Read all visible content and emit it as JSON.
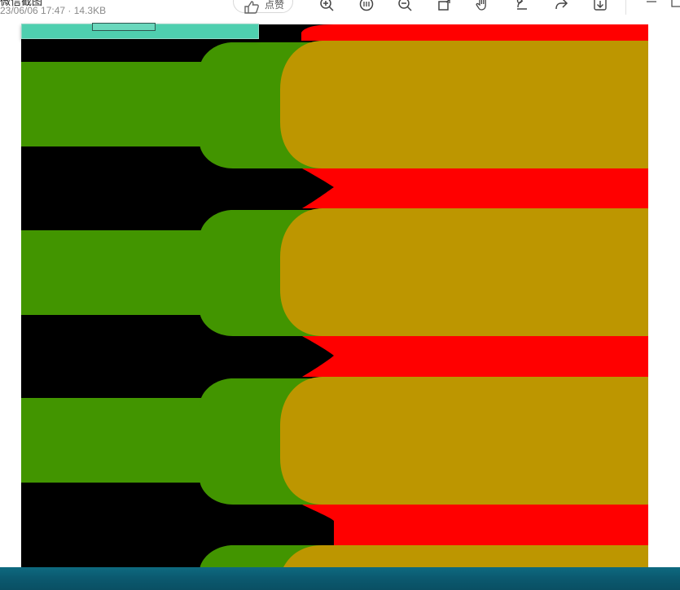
{
  "file": {
    "name": "微信截图",
    "meta": "23/06/06 17:47 · 14.3KB"
  },
  "toolbar": {
    "like_label": "点赞",
    "tools": [
      "zoom-in-icon",
      "fit-icon",
      "zoom-out-icon",
      "rotate-icon",
      "hand-icon",
      "edit-image-icon",
      "share-icon",
      "download-icon"
    ]
  },
  "colors": {
    "background": "#000000",
    "green": "#429500",
    "red": "#ff0000",
    "overlap": "#bd9600",
    "taskbar": "#0b5a70",
    "mini_window": "#4fcfaf"
  }
}
